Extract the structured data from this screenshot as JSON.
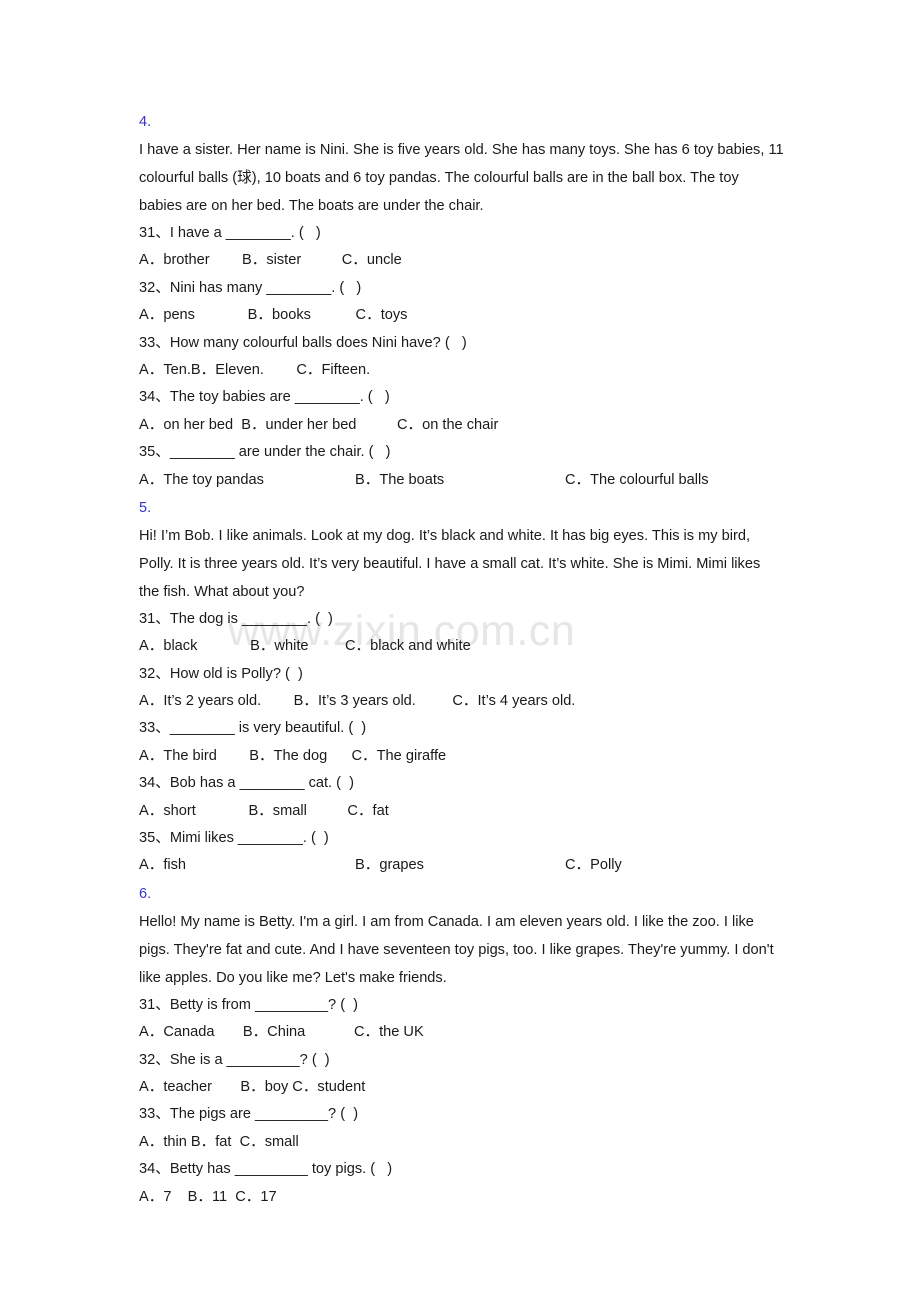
{
  "watermark": {
    "text": "www.zixin.com.cn"
  },
  "sections": [
    {
      "number": "4.",
      "passage": "I have a sister. Her name is Nini. She is five years old. She has many toys. She has 6 toy babies, 11 colourful balls (球), 10 boats and 6 toy pandas. The colourful balls are in the ball box. The toy babies are on her bed. The boats are under the chair.",
      "questions": [
        {
          "q": "31、I have a ________. (   )",
          "opts": "A．brother        B．sister          C．uncle",
          "layout": "inline"
        },
        {
          "q": "32、Nini has many ________. (   )",
          "opts": "A．pens             B．books           C．toys",
          "layout": "inline"
        },
        {
          "q": "33、How many colourful balls does Nini have? (   )",
          "opts": "A．Ten.B．Eleven.        C．Fifteen.",
          "layout": "inline"
        },
        {
          "q": "34、The toy babies are ________. (   )",
          "opts": "A．on her bed  B．under her bed          C．on the chair",
          "layout": "inline"
        },
        {
          "q": "35、________ are under the chair. (   )",
          "opts_cols": [
            "A．The toy pandas",
            "B．The boats",
            "C．The colourful balls"
          ],
          "layout": "cols"
        }
      ]
    },
    {
      "number": "5.",
      "passage": "Hi! I’m Bob. I like animals. Look at my dog. It’s black and white. It has big eyes. This is my bird, Polly. It is three years old. It’s very beautiful. I have a small cat. It’s white. She is Mimi. Mimi likes the fish. What about you?",
      "questions": [
        {
          "q": "31、The dog is ________. (  )",
          "opts": "A．black             B．white         C．black and white",
          "layout": "inline"
        },
        {
          "q": "32、How old is Polly? (  )",
          "opts": "A．It’s 2 years old.        B．It’s 3 years old.         C．It’s 4 years old.",
          "layout": "inline"
        },
        {
          "q": "33、________ is very beautiful. (  )",
          "opts": "A．The bird        B．The dog      C．The giraffe",
          "layout": "inline"
        },
        {
          "q": "34、Bob has a ________ cat. (  )",
          "opts": "A．short             B．small          C．fat",
          "layout": "inline"
        },
        {
          "q": "35、Mimi likes ________. (  )",
          "opts_cols": [
            "A．fish",
            "B．grapes",
            "C．Polly"
          ],
          "layout": "cols"
        }
      ]
    },
    {
      "number": "6.",
      "passage": "Hello! My name is Betty. I'm a girl. I am from Canada. I am eleven years old. I like the zoo. I like pigs. They're fat and cute. And I have seventeen toy pigs, too. I like grapes. They're yummy. I don't like apples. Do you like me? Let's make friends.",
      "questions": [
        {
          "q": "31、Betty is from _________? (  )",
          "opts": "A．Canada       B．China            C．the UK",
          "layout": "inline"
        },
        {
          "q": "32、She is a _________? (  )",
          "opts": "A．teacher       B．boy C．student",
          "layout": "inline"
        },
        {
          "q": "33、The pigs are _________? (  )",
          "opts": "A．thin B．fat  C．small",
          "layout": "inline"
        },
        {
          "q": "34、Betty has _________ toy pigs. (   )",
          "opts": "A．7    B．11  C．17",
          "layout": "inline"
        }
      ]
    }
  ]
}
